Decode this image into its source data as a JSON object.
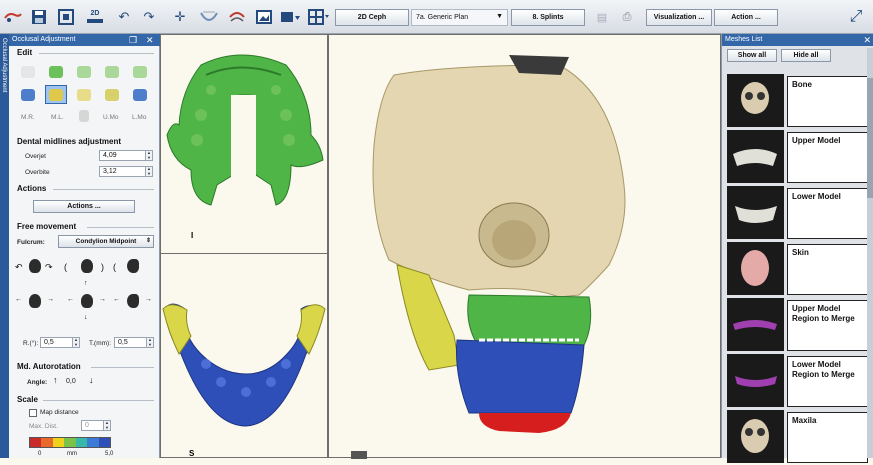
{
  "toolbar": {
    "ceph_button": "2D Ceph",
    "plan_select": "7a. Generic Plan",
    "splints_button": "8. Splints",
    "visualization_button": "Visualization ...",
    "action_button": "Action ...",
    "icon_2d_label": "2D",
    "icons": [
      "app-logo",
      "save",
      "layout-view",
      "2d-view",
      "undo",
      "redo",
      "crosshair",
      "jaw",
      "splint",
      "image",
      "views",
      "grid",
      "printer",
      "expand"
    ]
  },
  "side_tab": {
    "label": "Occlusal Adjustment"
  },
  "occlusal_panel": {
    "title": "Occlusal Adjustment",
    "edit_section": "Edit",
    "edit_labels": [
      "M.R.",
      "M.L.",
      "U.Mo",
      "L.Mo"
    ],
    "midlines_section": "Dental midlines adjustment",
    "overjet_label": "Overjet",
    "overjet_value": "4,09",
    "overbite_label": "Overbite",
    "overbite_value": "3,12",
    "actions_section": "Actions",
    "actions_button": "Actions ...",
    "free_section": "Free movement",
    "fulcrum_label": "Fulcrum:",
    "fulcrum_value": "Condylion Midpoint",
    "r_label": "R.(°):",
    "r_value": "0,5",
    "t_label": "T.(mm):",
    "t_value": "0,5",
    "autorot_section": "Md. Autorotation",
    "angle_label": "Angle:",
    "angle_value": "0,0",
    "scale_section": "Scale",
    "map_distance_label": "Map distance",
    "max_dist_label": "Max. Dist.",
    "max_dist_value": "0",
    "scale_min": "0",
    "scale_unit": "mm",
    "scale_max": "5,0",
    "scale_colors": [
      "#c92a2a",
      "#e8692a",
      "#f0d21e",
      "#7cc24a",
      "#37b8a8",
      "#3b7bd6",
      "#2f4fb8"
    ]
  },
  "views": {
    "top_left_marker": "I",
    "bottom_left_marker": "S"
  },
  "meshes_panel": {
    "title": "Meshes List",
    "show_all": "Show all",
    "hide_all": "Hide all",
    "items": [
      {
        "name": "Bone",
        "thumb": "bone-thumb"
      },
      {
        "name": "Upper Model",
        "thumb": "upper-model-thumb"
      },
      {
        "name": "Lower Model",
        "thumb": "lower-model-thumb"
      },
      {
        "name": "Skin",
        "thumb": "skin-thumb"
      },
      {
        "name": "Upper Model Region to Merge",
        "thumb": "upper-region-thumb"
      },
      {
        "name": "Lower Model Region to Merge",
        "thumb": "lower-region-thumb"
      },
      {
        "name": "Maxila",
        "thumb": "maxila-thumb"
      }
    ]
  },
  "colors": {
    "mesh_green": "#4fb546",
    "mesh_blue": "#2f4fb8",
    "mesh_yellow": "#d9d64a",
    "bone": "#e3d6b0",
    "panel_blue": "#3467a8"
  }
}
